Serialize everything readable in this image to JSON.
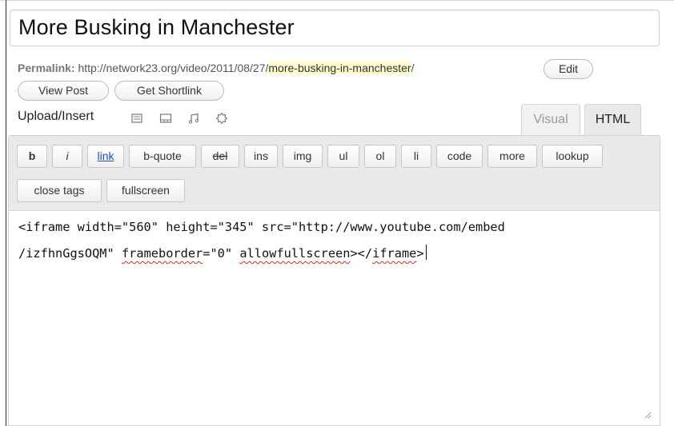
{
  "post": {
    "title": "More Busking in Manchester",
    "permalink_label": "Permalink:",
    "permalink_base": "http://network23.org/video/2011/08/27/",
    "permalink_slug": "more-busking-in-manchester",
    "permalink_suffix": "/",
    "edit_label": "Edit",
    "view_post_label": "View Post",
    "get_shortlink_label": "Get Shortlink"
  },
  "media": {
    "upload_label": "Upload/Insert",
    "icons": [
      "add-image-icon",
      "add-video-icon",
      "add-audio-icon",
      "add-media-icon"
    ]
  },
  "tabs": {
    "visual": "Visual",
    "html": "HTML",
    "active": "HTML"
  },
  "toolbar": {
    "row1": [
      "b",
      "i",
      "link",
      "b-quote",
      "del",
      "ins",
      "img",
      "ul",
      "ol",
      "li",
      "code",
      "more",
      "lookup"
    ],
    "row2": [
      "close tags",
      "fullscreen"
    ]
  },
  "content": {
    "line1": "<iframe width=\"560\" height=\"345\" src=\"http://www.youtube.com/embed",
    "line2_a": "/izfhnGgsOQM\" ",
    "line2_b": "frameborder",
    "line2_c": "=\"0\" ",
    "line2_d": "allowfullscreen",
    "line2_e": "></",
    "line2_f": "iframe",
    "line2_g": ">"
  },
  "colors": {
    "link_blue": "#1a4fc4",
    "slug_highlight": "#fffbcc",
    "spell_error": "#d72b2b"
  }
}
